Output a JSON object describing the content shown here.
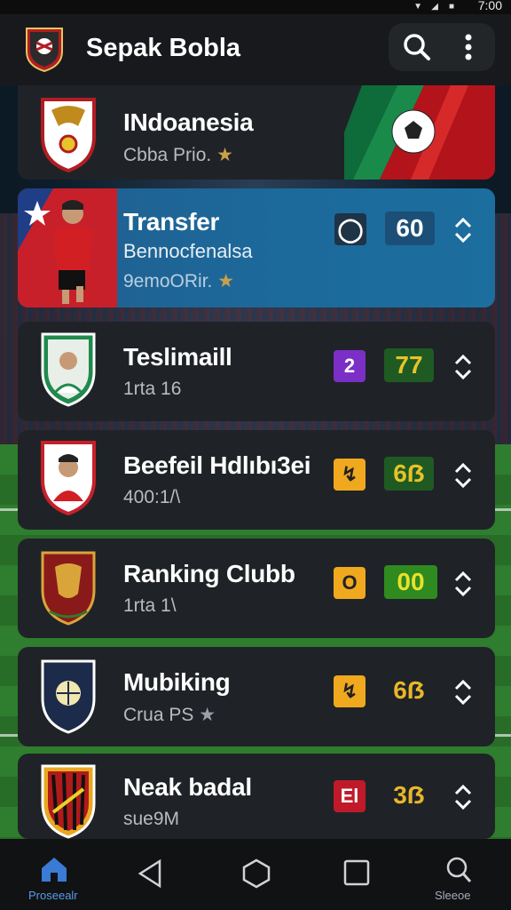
{
  "status_bar": {
    "time": "7:00"
  },
  "app": {
    "title": "Sepak Bobla"
  },
  "icons": {
    "search": "search-icon",
    "more": "more-vert-icon",
    "sort": "chevron-up-down-icon",
    "home": "home-icon",
    "back": "back-triangle-icon",
    "circle": "home-circle-icon",
    "square": "recents-square-icon",
    "find": "search-icon"
  },
  "colors": {
    "accent_blue": "#1c6a9c",
    "card_bg": "#1f2327",
    "score_green": "#2f7a2f",
    "score_yellow": "#e8c22a",
    "star": "#c9a14b"
  },
  "list": {
    "items": [
      {
        "title": "INdoanesia",
        "subtitle": "Cbba Prio.",
        "star": "★"
      },
      {
        "title": "Transfer",
        "line2": "Bennocfenalsa",
        "subtitle": "9emoORir.",
        "star": "★",
        "badge": "◯",
        "score": "60"
      },
      {
        "title": "Teslimaill",
        "subtitle": "1rta 16",
        "badge": "2",
        "score": "77"
      },
      {
        "title": "Beefeil Hdlıbı3ei",
        "subtitle": "400:1/\\",
        "badge": "↯",
        "score": "6ẞ"
      },
      {
        "title": "Ranking Clubb",
        "subtitle": "1rta 1\\",
        "badge": "O",
        "score": "00"
      },
      {
        "title": "Mubiking",
        "subtitle": "Crua PS",
        "star": "★",
        "badge": "↯",
        "score": "6ẞ"
      },
      {
        "title": "Neak badal",
        "subtitle": "sue9M",
        "badge": "El",
        "score": "3ẞ"
      }
    ]
  },
  "bottom_nav": {
    "items": [
      {
        "label": "Proseealr"
      },
      {
        "label": ""
      },
      {
        "label": ""
      },
      {
        "label": ""
      },
      {
        "label": "Sleeoe"
      }
    ]
  }
}
